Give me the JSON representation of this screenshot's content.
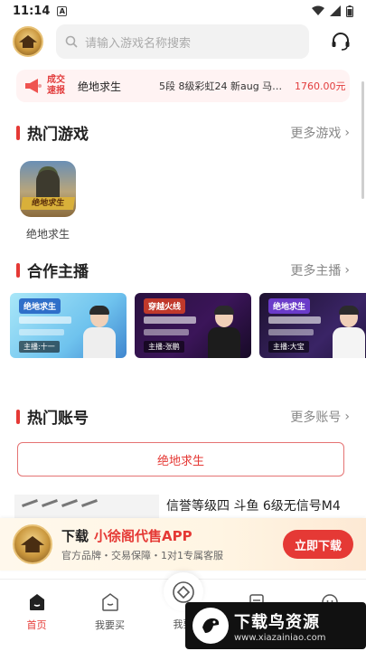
{
  "status_bar": {
    "time": "11:14",
    "notification": "A"
  },
  "header": {
    "search_placeholder": "请输入游戏名称搜索"
  },
  "ticker": {
    "badge_line1": "成交",
    "badge_line2": "速报",
    "game": "绝地求生",
    "description": "5段 8级彩虹24 新aug 马…",
    "price": "1760.00元"
  },
  "sections": {
    "hot_games": {
      "title": "热门游戏",
      "more": "更多游戏"
    },
    "streamers": {
      "title": "合作主播",
      "more": "更多主播"
    },
    "hot_accounts": {
      "title": "热门账号",
      "more": "更多账号"
    }
  },
  "games": [
    {
      "name": "绝地求生",
      "icon": "pubg-game-icon"
    }
  ],
  "streamer_cards": [
    {
      "tag": "绝地求生",
      "host": "主播:十一"
    },
    {
      "tag": "穿越火线",
      "host": "主播:张鹏"
    },
    {
      "tag": "绝地求生",
      "host": "主播:大宝"
    }
  ],
  "account_filter": {
    "label": "绝地求生"
  },
  "listing": {
    "title": "信誉等级四 斗鱼 6级无信号M4"
  },
  "promo": {
    "line1_prefix": "下载",
    "line1_app": "小徐阁代售APP",
    "line2": "官方品牌・交易保障・1对1专属客服",
    "button": "立即下载"
  },
  "tabbar": [
    {
      "label": "首页",
      "icon": "home-icon",
      "active": true
    },
    {
      "label": "我要买",
      "icon": "cart-icon",
      "active": false
    },
    {
      "label": "我要",
      "icon": "sell-icon",
      "active": false
    },
    {
      "label": "",
      "icon": "message-icon",
      "active": false
    },
    {
      "label": "",
      "icon": "profile-icon",
      "active": false
    }
  ],
  "watermark": {
    "title": "下载鸟资源",
    "url": "www.xiazainiao.com"
  },
  "colors": {
    "accent": "#e53935",
    "ticker_bg": "#fff3f3",
    "promo_bg": "#fff5e3"
  }
}
